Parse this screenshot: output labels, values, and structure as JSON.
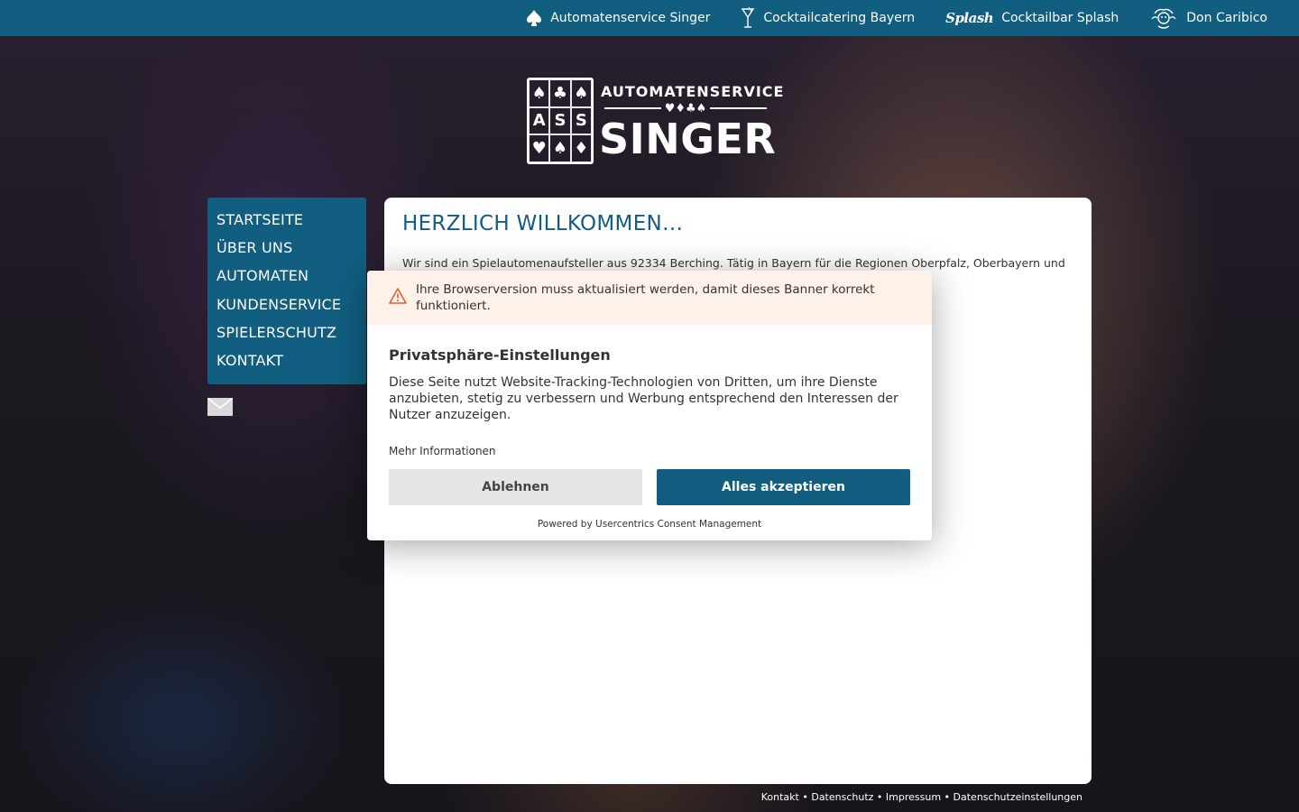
{
  "topbar": {
    "items": [
      {
        "label": "Automatenservice Singer",
        "icon": "spade-icon"
      },
      {
        "label": "Cocktailcatering Bayern",
        "icon": "cocktail-glass-icon"
      },
      {
        "label": "Cocktailbar Splash",
        "icon": "splash-logo-icon",
        "icon_text": "Splash"
      },
      {
        "label": "Don Caribico",
        "icon": "don-caribico-logo-icon"
      }
    ]
  },
  "logo": {
    "top_line": "AUTOMATENSERVICE",
    "main_line": "SINGER",
    "card_letters": [
      "A",
      "S",
      "S"
    ]
  },
  "sidebar": {
    "items": [
      {
        "label": "STARTSEITE"
      },
      {
        "label": "ÜBER UNS"
      },
      {
        "label": "AUTOMATEN"
      },
      {
        "label": "KUNDENSERVICE"
      },
      {
        "label": "SPIELERSCHUTZ"
      },
      {
        "label": "KONTAKT"
      }
    ]
  },
  "main": {
    "heading": "HERZLICH WILLKOMMEN…",
    "intro": "Wir sind ein Spielautomenaufsteller aus 92334 Berching. Tätig in Bayern für die Regionen Oberpfalz, Oberbayern und"
  },
  "footer": {
    "links": [
      "Kontakt",
      "Datenschutz",
      "Impressum",
      "Datenschutzeinstellungen"
    ],
    "separator": " • "
  },
  "consent": {
    "warning": "Ihre Browserversion muss aktualisiert werden, damit dieses Banner korrekt funktioniert.",
    "title": "Privatsphäre-Einstellungen",
    "description": "Diese Seite nutzt Website-Tracking-Technologien von Dritten, um ihre Dienste anzubieten, stetig zu verbessern und Werbung entsprechend den Interessen der Nutzer anzuzeigen.",
    "more_info": "Mehr Informationen",
    "deny_label": "Ablehnen",
    "accept_label": "Alles akzeptieren",
    "powered_by": "Powered by Usercentrics Consent Management"
  },
  "colors": {
    "brand": "#115e80",
    "warning_bg": "#fdf1ea",
    "warning_icon": "#e06030",
    "deny_bg": "#e6e6e6"
  }
}
